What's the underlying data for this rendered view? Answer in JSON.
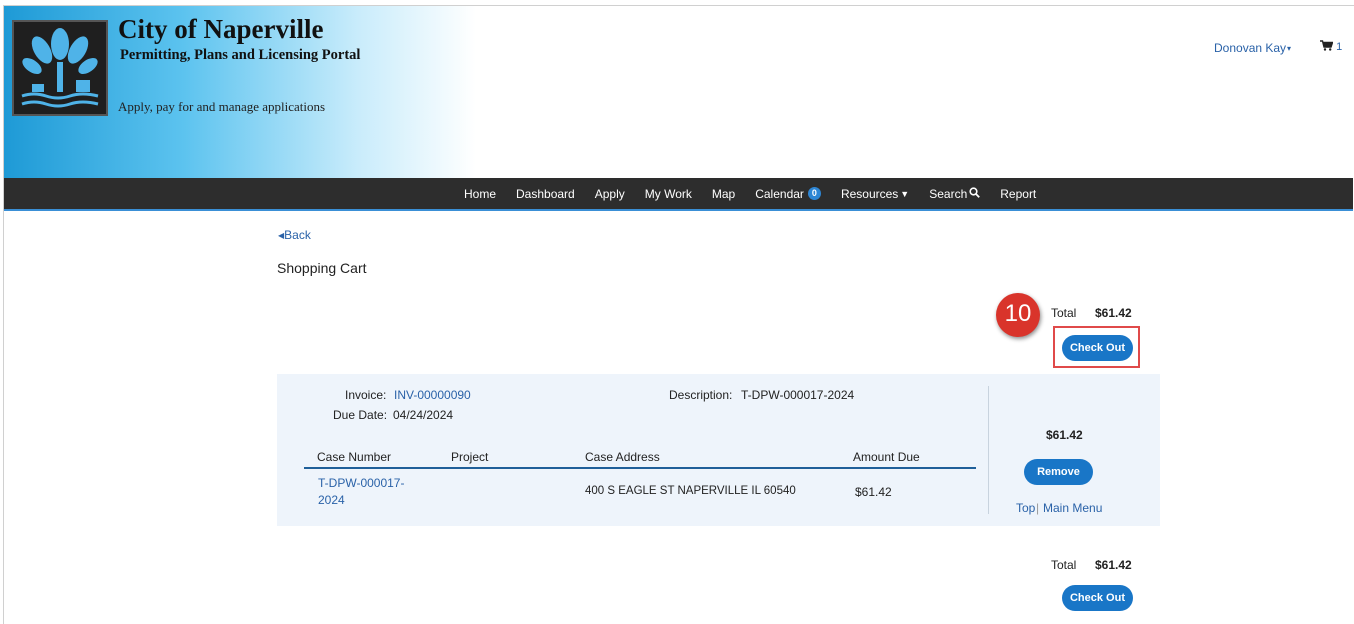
{
  "header": {
    "site_title": "City of Naperville",
    "site_subtitle": "Permitting, Plans and Licensing Portal",
    "tagline": "Apply, pay for and manage applications",
    "user_name": "Donovan Kay",
    "cart_count": "1"
  },
  "nav": {
    "items": [
      {
        "label": "Home"
      },
      {
        "label": "Dashboard"
      },
      {
        "label": "Apply"
      },
      {
        "label": "My Work"
      },
      {
        "label": "Map"
      },
      {
        "label": "Calendar",
        "badge": "0"
      },
      {
        "label": "Resources"
      },
      {
        "label": "Search"
      },
      {
        "label": "Report"
      }
    ]
  },
  "page": {
    "back_label": "Back",
    "title": "Shopping Cart",
    "total_label": "Total",
    "total_value": "$61.42",
    "checkout_label": "Check Out",
    "step_number": "10"
  },
  "invoice": {
    "invoice_label": "Invoice:",
    "invoice_number": "INV-00000090",
    "due_date_label": "Due Date:",
    "due_date": "04/24/2024",
    "description_label": "Description:",
    "description": "T-DPW-000017-2024",
    "columns": [
      "Case Number",
      "Project",
      "Case Address",
      "Amount Due"
    ],
    "rows": [
      {
        "case_number_line1": "T-DPW-000017-",
        "case_number_line2": "2024",
        "project": "",
        "case_address": "400 S EAGLE ST NAPERVILLE IL 60540",
        "amount_due": "$61.42"
      }
    ],
    "amount": "$61.42",
    "remove_label": "Remove",
    "top_link": "Top",
    "separator": "|",
    "main_menu_link": "Main Menu"
  },
  "colors": {
    "nav_bg": "#2d2d2d",
    "accent_blue": "#1976c7",
    "link_blue": "#2a62a8",
    "highlight_red": "#e04a4a",
    "panel_bg": "#eef4fb"
  }
}
